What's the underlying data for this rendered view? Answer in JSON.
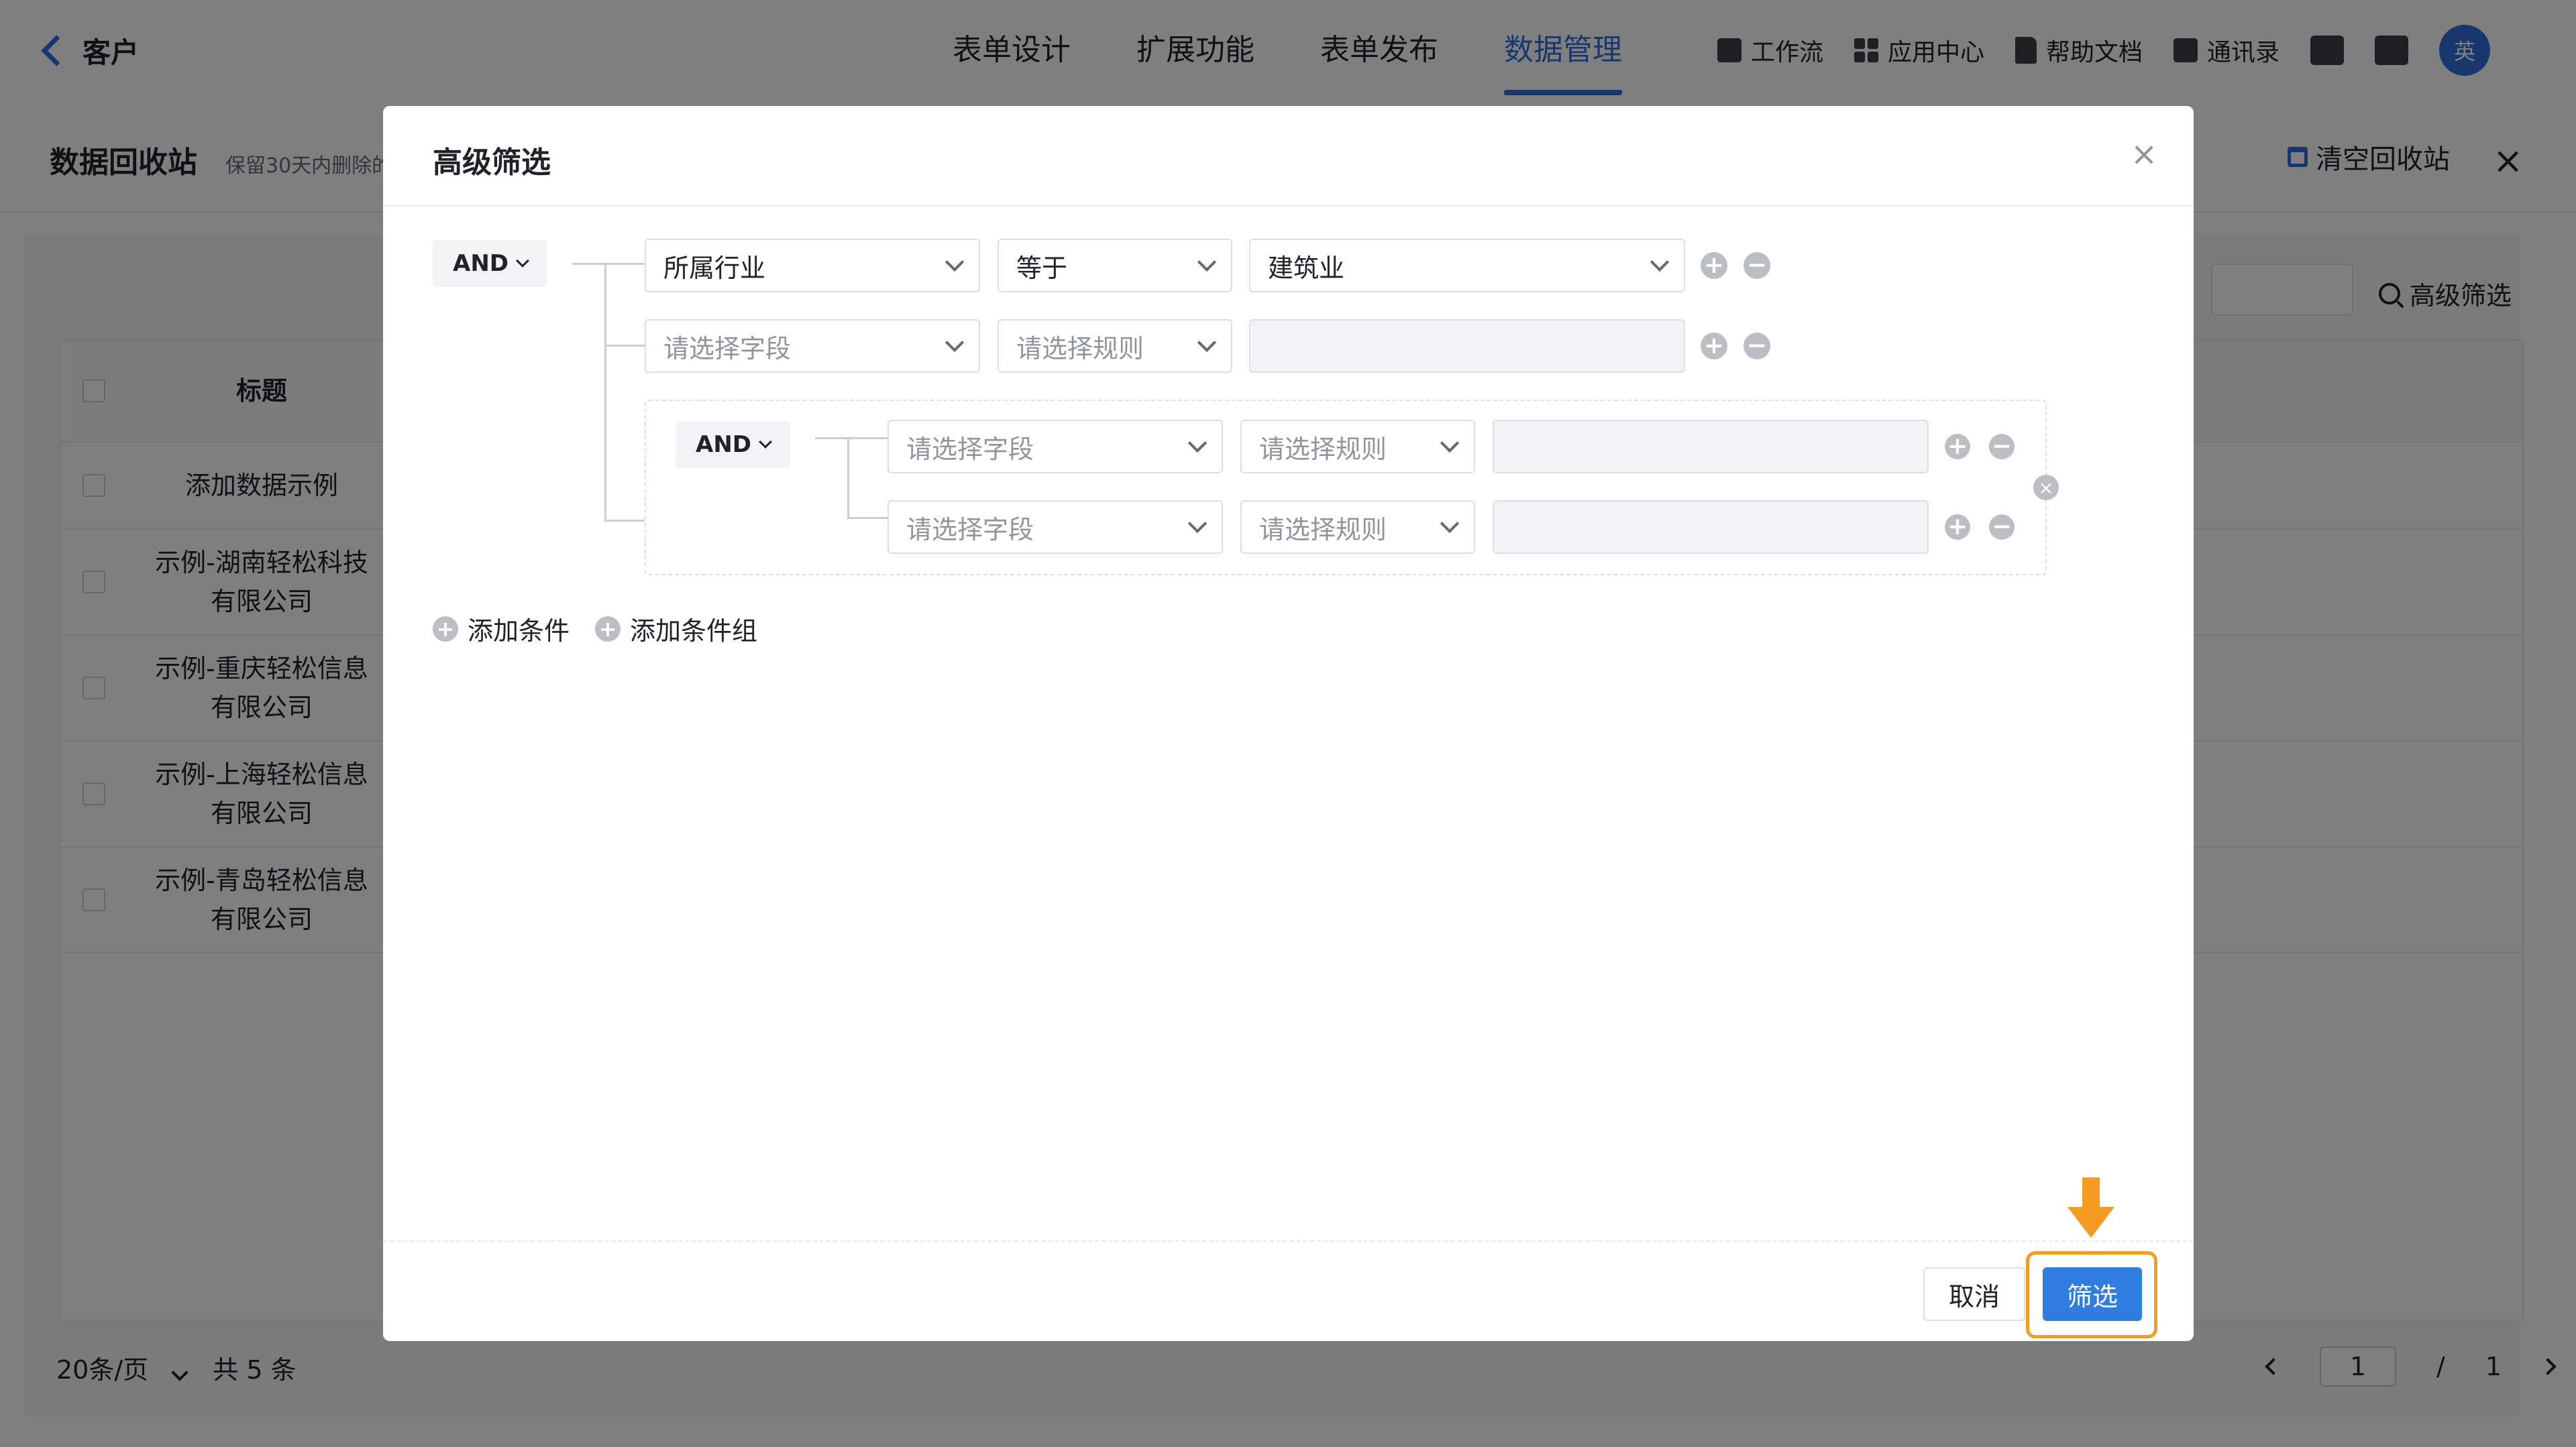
{
  "nav": {
    "back_label": "客户",
    "tabs": [
      {
        "label": "表单设计"
      },
      {
        "label": "扩展功能"
      },
      {
        "label": "表单发布"
      },
      {
        "label": "数据管理"
      }
    ],
    "active_tab": "数据管理",
    "tools": {
      "workflow": "工作流",
      "app_center": "应用中心",
      "help_docs": "帮助文档",
      "contacts": "通讯录",
      "avatar_text": "英"
    }
  },
  "drawer": {
    "title": "数据回收站",
    "subtitle": "保留30天内删除的",
    "clear_label": "清空回收站",
    "advanced_filter_label": "高级筛选",
    "table": {
      "header_title": "标题",
      "rows": [
        {
          "title_line1": "添加数据示例",
          "title_line2": ""
        },
        {
          "title_line1": "示例-湖南轻松科技",
          "title_line2": "有限公司"
        },
        {
          "title_line1": "示例-重庆轻松信息",
          "title_line2": "有限公司"
        },
        {
          "title_line1": "示例-上海轻松信息",
          "title_line2": "有限公司"
        },
        {
          "title_line1": "示例-青岛轻松信息",
          "title_line2": "有限公司"
        }
      ]
    },
    "pager": {
      "page_size": "20条/页",
      "total": "共 5 条",
      "current_page": "1",
      "separator": "/",
      "total_pages": "1"
    }
  },
  "modal": {
    "title": "高级筛选",
    "root_operator": "AND",
    "conditions": [
      {
        "field": "所属行业",
        "rule": "等于",
        "value": "建筑业"
      },
      {
        "field_placeholder": "请选择字段",
        "rule_placeholder": "请选择规则",
        "value": ""
      }
    ],
    "group": {
      "operator": "AND",
      "conditions": [
        {
          "field_placeholder": "请选择字段",
          "rule_placeholder": "请选择规则",
          "value": ""
        },
        {
          "field_placeholder": "请选择字段",
          "rule_placeholder": "请选择规则",
          "value": ""
        }
      ]
    },
    "add_condition_label": "添加条件",
    "add_group_label": "添加条件组",
    "cancel_label": "取消",
    "confirm_label": "筛选"
  },
  "colors": {
    "accent": "#2f6fdd",
    "primary_button": "#2f7de1",
    "highlight": "#f59a23"
  },
  "icons": {
    "plus": "+",
    "minus": "−",
    "close": "×"
  }
}
